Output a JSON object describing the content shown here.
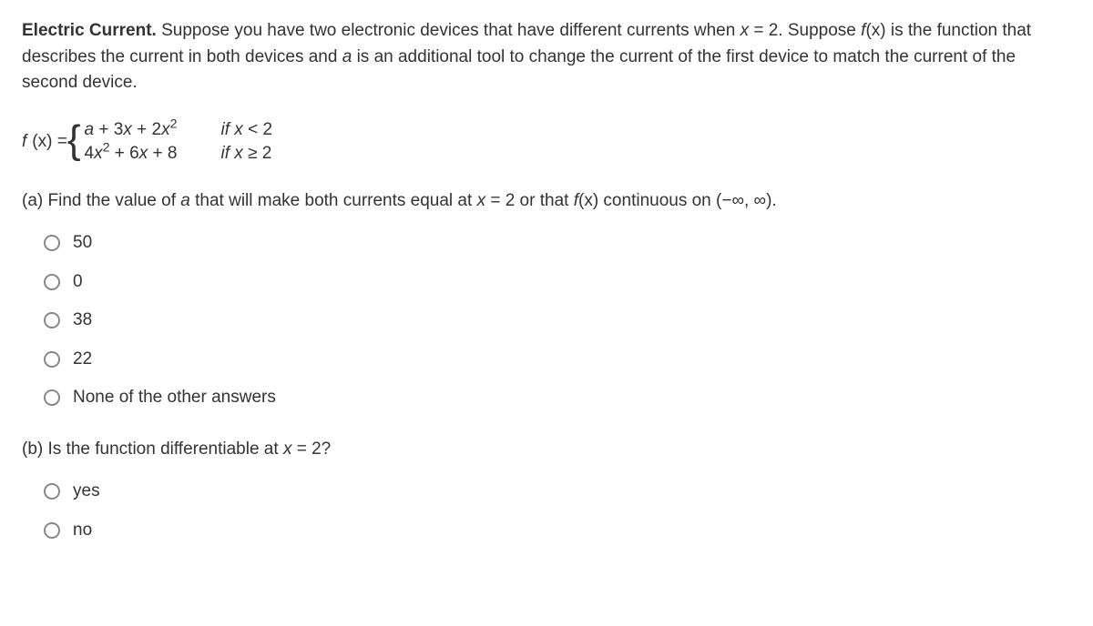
{
  "intro": {
    "title": "Electric Current.",
    "text_part1": " Suppose you have two electronic devices that have different currents when ",
    "var_x": "x",
    "eq_text": " = 2. Suppose ",
    "fx": "f",
    "paren_x": "(x)",
    "text_part2": " is the function that describes the current in both devices and ",
    "var_a": "a",
    "text_part3": " is an additional tool to change the current of the first device to match the current of the second device."
  },
  "equation": {
    "label_f": "f",
    "label_paren": "(x) = ",
    "piece1_expr_a": "a",
    "piece1_expr_rest": " + 3",
    "piece1_x1": "x",
    "piece1_plus": " + 2",
    "piece1_x2": "x",
    "piece1_sup": "2",
    "piece1_cond_if": "if ",
    "piece1_cond_x": "x",
    "piece1_cond_rest": " < 2",
    "piece2_4": "4",
    "piece2_x1": "x",
    "piece2_sup": "2",
    "piece2_mid": " + 6",
    "piece2_x2": "x",
    "piece2_plus8": " + 8",
    "piece2_cond_if": "if ",
    "piece2_cond_x": "x",
    "piece2_cond_rest": " ≥ 2"
  },
  "question_a": {
    "prefix": "(a) Find the value of ",
    "var_a": "a",
    "mid1": " that will make both currents equal at ",
    "var_x": "x",
    "mid2": " = 2 or that ",
    "fx_f": "f",
    "fx_paren": "(x)",
    "mid3": " continuous on (−∞, ∞)."
  },
  "options_a": [
    "50",
    "0",
    "38",
    "22",
    "None of the other answers"
  ],
  "question_b": {
    "prefix": "(b) Is the function differentiable at ",
    "var_x": "x",
    "suffix": " = 2?"
  },
  "options_b": [
    "yes",
    "no"
  ]
}
